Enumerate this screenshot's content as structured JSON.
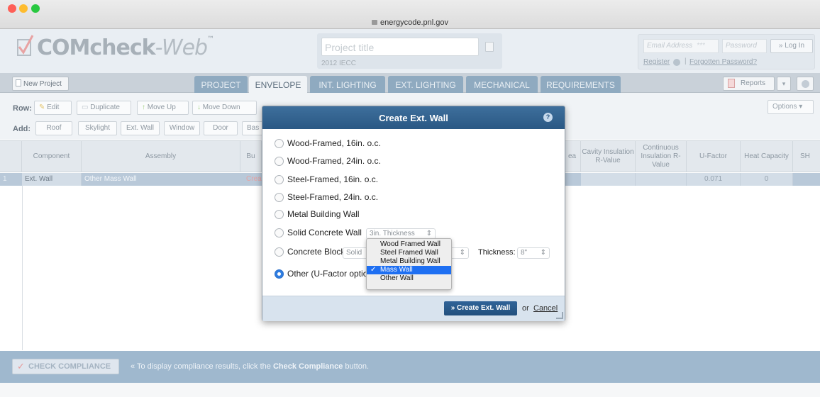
{
  "browser": {
    "url": "energycode.pnl.gov",
    "colors": {
      "close": "#fe5f57",
      "minimize": "#febc2e",
      "maximize": "#28c840"
    }
  },
  "header": {
    "logo_main": "COMcheck",
    "logo_web": "-Web",
    "logo_tm": "™",
    "project_title_placeholder": "Project title",
    "code": "2012 IECC",
    "email_placeholder": "Email Address",
    "password_placeholder": "Password",
    "login_label": "» Log In",
    "register_label": "Register",
    "forgot_label": "Forgotten Password?"
  },
  "tabs": {
    "new_project": "New Project",
    "items": [
      "PROJECT",
      "ENVELOPE",
      "INT. LIGHTING",
      "EXT. LIGHTING",
      "MECHANICAL",
      "REQUIREMENTS"
    ],
    "active": "ENVELOPE",
    "reports": "Reports"
  },
  "toolbar": {
    "row_label": "Row:",
    "add_label": "Add:",
    "row_buttons": [
      "Edit",
      "Duplicate",
      "Move Up",
      "Move Down"
    ],
    "add_buttons": [
      "Roof",
      "Skylight",
      "Ext. Wall",
      "Window",
      "Door",
      "Bas"
    ],
    "options": "Options"
  },
  "table": {
    "headers": {
      "component": "Component",
      "assembly": "Assembly",
      "b_partial": "Bu",
      "area_partial": "ea",
      "cavity": "Cavity Insulation R-Value",
      "continuous": "Continuous Insulation R-Value",
      "ufactor": "U-Factor",
      "heat": "Heat Capacity",
      "shgc_partial": "SH"
    },
    "row": {
      "num": "1",
      "component": "Ext. Wall",
      "assembly": "Other Mass Wall",
      "b_partial": "Crea",
      "ufactor": "0.071",
      "heat": "0"
    }
  },
  "bottom": {
    "check_label": "CHECK COMPLIANCE",
    "msg_prefix": "« To display compliance results, click the ",
    "msg_bold": "Check Compliance",
    "msg_suffix": " button."
  },
  "modal": {
    "title": "Create Ext. Wall",
    "options": [
      "Wood-Framed, 16in. o.c.",
      "Wood-Framed, 24in. o.c.",
      "Steel-Framed, 16in. o.c.",
      "Steel-Framed, 24in. o.c.",
      "Metal Building Wall",
      "Solid Concrete Wall",
      "Concrete Block",
      "Other (U-Factor option)"
    ],
    "selected_option": "Other (U-Factor option)",
    "concrete_thickness": "3in. Thickness",
    "block_select": "Solid",
    "thickness_label": "Thickness:",
    "thickness_value": "8\"",
    "create_label": "» Create Ext. Wall",
    "or": "or",
    "cancel": "Cancel"
  },
  "dropdown": {
    "items": [
      "Wood Framed Wall",
      "Steel Framed Wall",
      "Metal Building Wall",
      "Mass Wall",
      "Other Wall"
    ],
    "selected": "Mass Wall"
  }
}
